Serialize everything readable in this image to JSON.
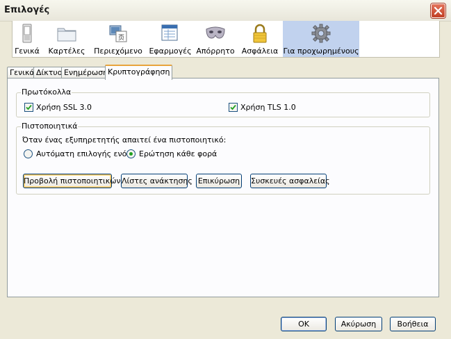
{
  "window": {
    "title": "Επιλογές"
  },
  "toolbar": {
    "items": [
      {
        "label": "Γενικά",
        "icon": "general-switch-icon"
      },
      {
        "label": "Καρτέλες",
        "icon": "folder-tabs-icon"
      },
      {
        "label": "Περιεχόμενο",
        "icon": "content-icon"
      },
      {
        "label": "Εφαρμογές",
        "icon": "applications-icon"
      },
      {
        "label": "Απόρρητο",
        "icon": "privacy-mask-icon"
      },
      {
        "label": "Ασφάλεια",
        "icon": "security-lock-icon"
      },
      {
        "label": "Για προχωρημένους",
        "icon": "advanced-gear-icon",
        "selected": true
      }
    ]
  },
  "tabs": [
    {
      "label": "Γενικά"
    },
    {
      "label": "Δίκτυο"
    },
    {
      "label": "Ενημέρωση"
    },
    {
      "label": "Κρυπτογράφηση",
      "active": true
    }
  ],
  "protocols": {
    "title": "Πρωτόκολλα",
    "ssl_label": "Χρήση SSL 3.0",
    "ssl_checked": true,
    "tls_label": "Χρήση TLS 1.0",
    "tls_checked": true
  },
  "certificates": {
    "title": "Πιστοποιητικά",
    "prompt": "Όταν ένας εξυπηρετητής απαιτεί ένα πιστοποιητικό:",
    "option_auto": "Αυτόματη επιλογής ενός",
    "option_ask": "Ερώτηση κάθε φορά",
    "selected_option": "ask",
    "buttons": {
      "view": "Προβολή πιστοποιητικών",
      "revocation": "Λίστες ανάκτησης",
      "validation": "Επικύρωση",
      "devices": "Συσκευές ασφαλείας"
    }
  },
  "footer": {
    "ok": "OK",
    "cancel": "Ακύρωση",
    "help": "Βοήθεια"
  },
  "colors": {
    "accent_tab": "#e8a33b",
    "selected_toolbar": "#c1d2ee",
    "close": "#c13f26"
  }
}
